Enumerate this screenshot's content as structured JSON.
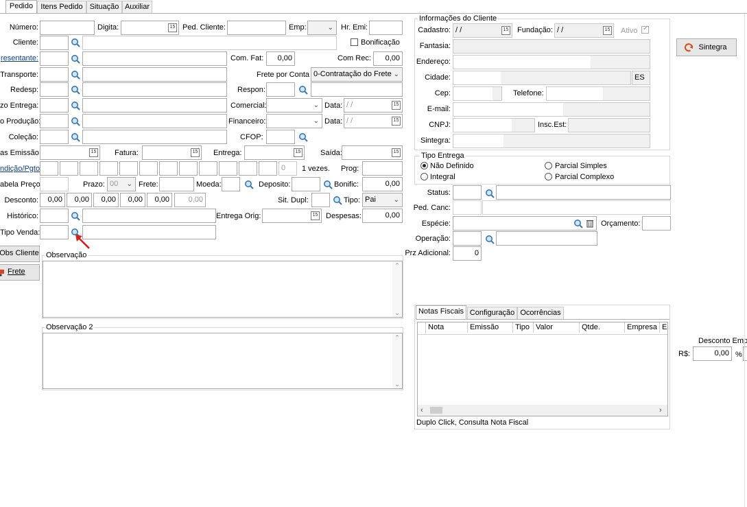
{
  "tabs": [
    "Pedido",
    "Itens Pedido",
    "Situação",
    "Auxiliar"
  ],
  "labels": {
    "numero": "Número:",
    "digita": "Digita:",
    "ped_cliente": "Ped. Cliente:",
    "emp": "Emp:",
    "hr_emi": "Hr. Emi:",
    "cliente": "Cliente:",
    "bonificacao": "Bonificação",
    "representante": "resentante:",
    "com_fat": "Com. Fat:",
    "com_rec": "Com Rec:",
    "transporte": "Transporte:",
    "frete_por_conta": "Frete por Conta",
    "redesp": "Redesp:",
    "respon": "Respon:",
    "prazo_entrega": "zo Entrega:",
    "comercial": "Comercial:",
    "data1": "Data:",
    "producao": "o Produção:",
    "financeiro": "Financeiro:",
    "data2": "Data:",
    "colecao": "Coleção:",
    "cfop": "CFOP:",
    "datas_emissao": "as Emissão:",
    "fatura": "Fatura:",
    "entrega": "Entrega:",
    "saida": "Saída:",
    "condicao_pgto": "ndição/Pgto:",
    "vezes": "1 vezes.",
    "prog": "Prog:",
    "tabela_preco": "abela Preço:",
    "prazo": "Prazo:",
    "frete": "Frete:",
    "moeda": "Moeda:",
    "deposito": "Deposito:",
    "bonific": "Bonific:",
    "desconto": "Desconto:",
    "sit_dupl": "Sit. Dupl:",
    "tipo": "Tipo:",
    "historico": "Histórico:",
    "entrega_orig": "Entrega Orig:",
    "despesas": "Despesas:",
    "tipo_venda": "Tipo Venda:",
    "observacao": "Observação",
    "observacao2": "Observação 2",
    "info_cliente": "Informações do Cliente",
    "cadastro": "Cadastro:",
    "fundacao": "Fundação:",
    "ativo": "Ativo",
    "fantasia": "Fantasia:",
    "endereco": "Endereço:",
    "cidade": "Cidade:",
    "cep": "Cep:",
    "telefone": "Telefone:",
    "email": "E-mail:",
    "cnpj": "CNPJ:",
    "insc_est": "Insc.Est:",
    "sintegra": "Sintegra:",
    "tipo_entrega": "Tipo Entrega",
    "nao_definido": "Não Definido",
    "parcial_simples": "Parcial Simples",
    "integral": "Integral",
    "parcial_complexo": "Parcial Complexo",
    "status": "Status:",
    "ped_canc": "Ped. Canc:",
    "especie": "Espécie:",
    "orcamento": "Orçamento:",
    "operacao": "Operação:",
    "prz_adicional": "Prz Adicional:",
    "desconto_emp": "Desconto Empr",
    "rs": "R$:",
    "pct": "%",
    "footer": "Duplo Click, Consulta Nota Fiscal"
  },
  "values": {
    "com_fat": "0,00",
    "com_rec": "0,00",
    "frete_conta": "0-Contratação do Frete",
    "date_blank": " / /",
    "cal": "15",
    "parcelas_count": "0",
    "prazo": "00",
    "bonific": "0,00",
    "desconto": [
      "0,00",
      "0,00",
      "0,00",
      "0,00",
      "0,00",
      "0,00"
    ],
    "tipo": "Pai",
    "despesas": "0,00",
    "uf": "ES",
    "prz_adicional": "0",
    "desconto_emp": "0,00"
  },
  "buttons": {
    "sintegra": "Sintegra",
    "obs_cliente": "Obs Cliente",
    "frete": "Frete"
  },
  "nf_tabs": [
    "Notas Fiscais",
    "Configuração",
    "Ocorrências"
  ],
  "nf_columns": [
    "Nota",
    "Emissão",
    "Tipo",
    "Valor",
    "Qtde.",
    "Empresa",
    "E"
  ],
  "colors": {
    "accent": "#0b3d91",
    "arrow": "#d81e1e",
    "border": "#a9a9a9",
    "readonly": "#f0f0f0"
  }
}
